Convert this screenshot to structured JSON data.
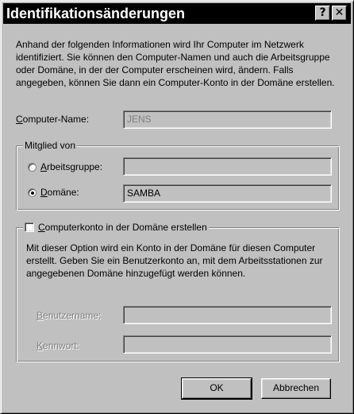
{
  "window": {
    "title": "Identifikationsänderungen",
    "help_button": "?",
    "close_button": "✕"
  },
  "intro_text": "Anhand der folgenden Informationen wird Ihr Computer im Netzwerk identifiziert. Sie können den Computer-Namen und auch die Arbeitsgruppe oder Domäne, in der der Computer erscheinen wird, ändern. Falls angegeben, können Sie dann ein Computer-Konto in der Domäne erstellen.",
  "computer_name": {
    "label_mnemonic": "C",
    "label_rest": "omputer-Name:",
    "value": "JENS",
    "enabled": false
  },
  "member_group": {
    "legend": "Mitglied von",
    "workgroup": {
      "label_mnemonic": "A",
      "label_rest": "rbeitsgruppe:",
      "selected": false,
      "value": ""
    },
    "domain": {
      "label_mnemonic": "D",
      "label_rest": "omäne:",
      "selected": true,
      "value": "SAMBA"
    }
  },
  "account_group": {
    "checkbox_mnemonic": "C",
    "checkbox_rest": "omputerkonto in der Domäne erstellen",
    "checked": false,
    "description": "Mit dieser Option wird ein Konto in der Domäne für diesen Computer erstellt. Geben Sie ein Benutzerkonto an, mit dem Arbeitsstationen zur angegebenen Domäne hinzugefügt werden können.",
    "username": {
      "label_mnemonic": "B",
      "label_rest": "enutzername:",
      "value": ""
    },
    "password": {
      "label_mnemonic": "K",
      "label_rest": "ennwort:",
      "value": ""
    }
  },
  "buttons": {
    "ok": "OK",
    "cancel": "Abbrechen"
  }
}
